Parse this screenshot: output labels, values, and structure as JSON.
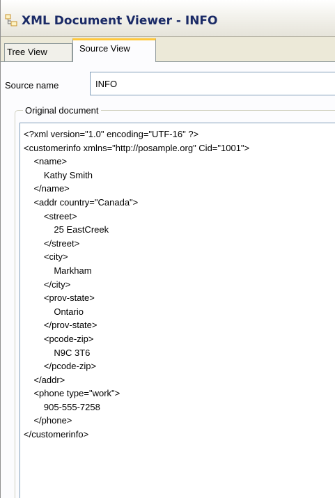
{
  "window": {
    "title": "XML Document Viewer - INFO",
    "icon": "xml-document-icon"
  },
  "tabs": [
    {
      "label": "Tree View",
      "selected": false
    },
    {
      "label": "Source View",
      "selected": true
    }
  ],
  "source": {
    "label": "Source name",
    "value": "INFO"
  },
  "original_document": {
    "legend": "Original document",
    "text": "<?xml version=\"1.0\" encoding=\"UTF-16\" ?>\n<customerinfo xmlns=\"http://posample.org\" Cid=\"1001\">\n    <name>\n        Kathy Smith\n    </name>\n    <addr country=\"Canada\">\n        <street>\n            25 EastCreek\n        </street>\n        <city>\n            Markham\n        </city>\n        <prov-state>\n            Ontario\n        </prov-state>\n        <pcode-zip>\n            N9C 3T6\n        </pcode-zip>\n    </addr>\n    <phone type=\"work\">\n        905-555-7258\n    </phone>\n</customerinfo>"
  },
  "colors": {
    "title_text": "#1a2a66",
    "selected_tab_highlight": "#ffc83c",
    "window_background": "#ece9d8"
  }
}
